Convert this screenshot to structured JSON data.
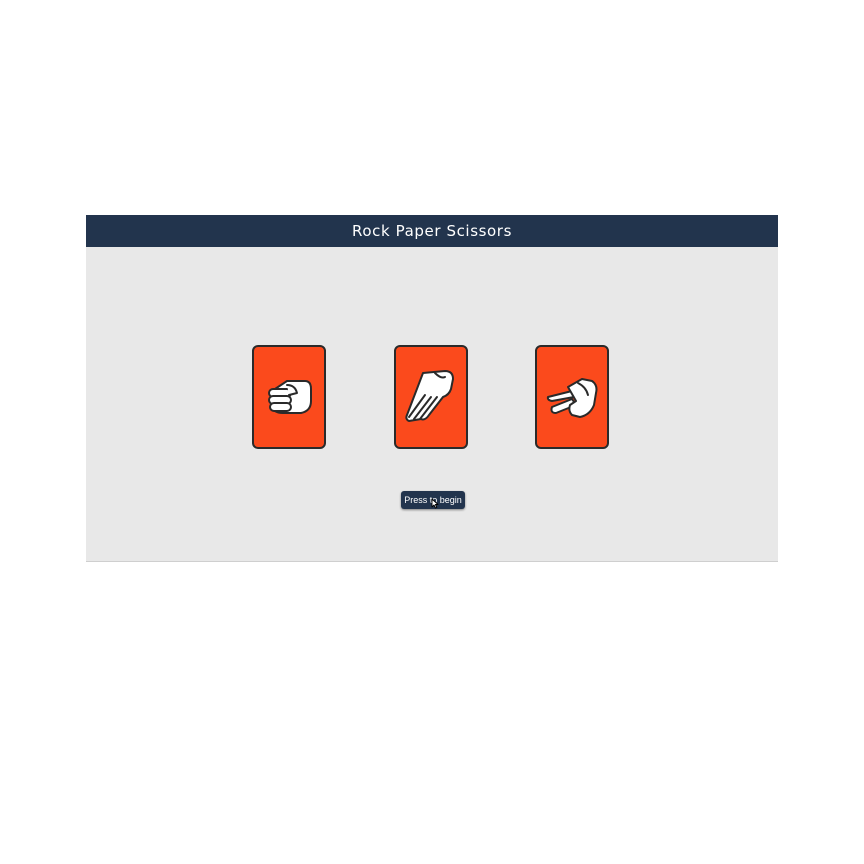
{
  "header": {
    "title": "Rock Paper Scissors"
  },
  "cards": [
    {
      "name": "rock",
      "icon": "rock-fist-icon"
    },
    {
      "name": "paper",
      "icon": "paper-open-hand-icon"
    },
    {
      "name": "scissors",
      "icon": "scissors-v-hand-icon"
    }
  ],
  "start_button": {
    "label": "Press to begin"
  },
  "colors": {
    "header_bg": "#22344d",
    "app_bg": "#e8e8e8",
    "card_bg": "#fb4a1c",
    "hand_fill": "#ffffff"
  }
}
